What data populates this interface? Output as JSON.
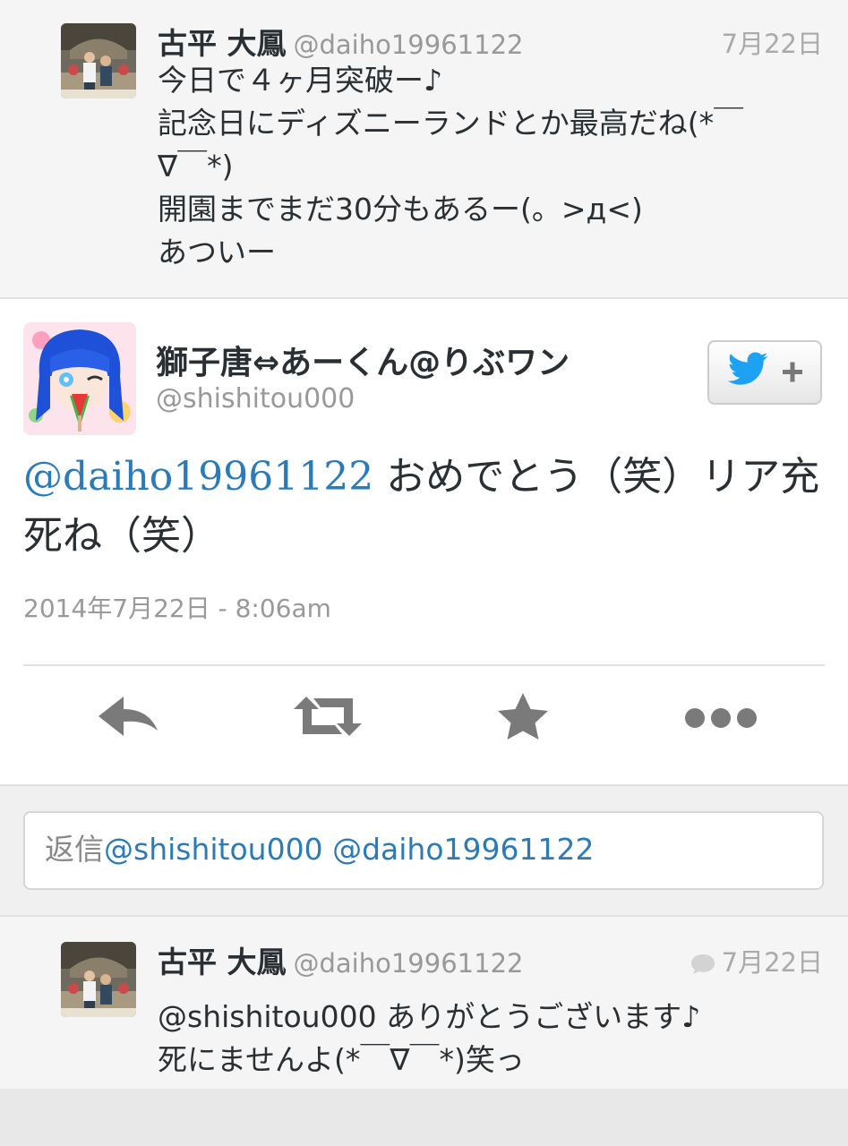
{
  "context_tweet_1": {
    "name": "古平 大鳳",
    "handle": "@daiho19961122",
    "date": "7月22日",
    "lines": [
      "今日で４ヶ月突破ー♪",
      "記念日にディズニーランドとか最高だね(*￣",
      "∇￣*)",
      "開園までまだ30分もあるー(。>д<)",
      "あついー"
    ]
  },
  "main_tweet": {
    "name": "獅子唐⇔あーくん@りぶワン",
    "handle": "@shishitou000",
    "mention": "@daiho19961122",
    "text": " おめでとう（笑）リア充死ね（笑）",
    "timestamp": "2014年7月22日 - 8:06am",
    "actions": [
      "reply",
      "retweet",
      "favorite",
      "more"
    ]
  },
  "reply_box": {
    "prefix": "返信",
    "mentions": "@shishitou000 @daiho19961122"
  },
  "context_tweet_2": {
    "name": "古平 大鳳",
    "handle": "@daiho19961122",
    "date": "7月22日",
    "lines": [
      "@shishitou000 ありがとうございます♪",
      "死にませんよ(*￣∇￣*)笑っ"
    ]
  },
  "colors": {
    "link": "#2b7bb9",
    "twitter_blue": "#1da1f2",
    "icon_gray": "#7a7a7a"
  }
}
